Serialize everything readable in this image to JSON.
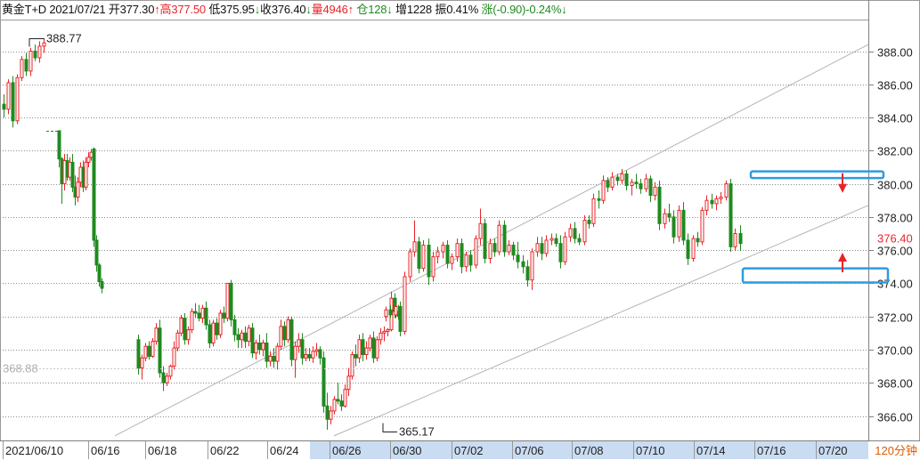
{
  "header": {
    "symbol": "黄金T+D",
    "date": "2021/07/21",
    "open_label": "开",
    "open_value": "377.30",
    "open_arrow": "↑",
    "high_label": "高",
    "high_value": "377.50",
    "low_label": "低",
    "low_value": "375.95",
    "low_arrow": "↓",
    "close_label": "收",
    "close_value": "376.40",
    "close_arrow": "↓",
    "volume_label": "量",
    "volume_value": "4946",
    "volume_arrow": "↑",
    "oi_label": "仓",
    "oi_value": "128",
    "oi_arrow": "↓",
    "inc_label": "增",
    "inc_value": "1228",
    "amp_label": "振",
    "amp_value": "0.41%",
    "chg_label": "涨",
    "chg_value": "(-0.90)-0.24%",
    "chg_arrow": "↓"
  },
  "period_label": "120分钟",
  "colors": {
    "up": "#e8252a",
    "down": "#1f8a1f",
    "grid": "#8c8c8c",
    "highlight_box": "#2f9be0",
    "date_band": "#c9dcf2",
    "trendline": "#b4b4b4",
    "signal_arrow": "#e8252a"
  },
  "chart_data": {
    "type": "candlestick",
    "y_axis": {
      "min": 364.8,
      "max": 390.0,
      "ticks": [
        "366.00",
        "368.00",
        "370.00",
        "372.00",
        "374.00",
        "376.00",
        "378.00",
        "380.00",
        "382.00",
        "384.00",
        "386.00",
        "388.00"
      ],
      "side": "right"
    },
    "x_axis": {
      "labels": [
        "2021/06/10",
        "06/16",
        "06/18",
        "06/22",
        "06/24",
        "06/26",
        "06/30",
        "07/02",
        "07/06",
        "07/08",
        "07/10",
        "07/14",
        "07/16",
        "07/20"
      ],
      "highlight_range": [
        "06/26",
        "07/20"
      ]
    },
    "annotations": {
      "max_label": "388.77",
      "max_value": 388.77,
      "min_label": "365.17",
      "min_value": 365.17,
      "ref_label": "368.88",
      "ref_value": 368.88,
      "last_label": "376.40",
      "last_value": 376.4
    },
    "channel_lines": [
      {
        "from": {
          "date": "06/16",
          "value": 364.8
        },
        "to": {
          "date": "07/20+",
          "value": 388.4
        }
      },
      {
        "from": {
          "date": "06/26",
          "value": 364.8
        },
        "to": {
          "date": "07/20+",
          "value": 378.7
        }
      }
    ],
    "zones": [
      {
        "name": "resistance",
        "low": 380.35,
        "high": 380.75
      },
      {
        "name": "support",
        "low": 374.05,
        "high": 374.9
      }
    ],
    "signals": [
      {
        "direction": "down",
        "at_value": 380.1
      },
      {
        "direction": "up",
        "at_value": 375.2
      }
    ],
    "candles": [
      [
        384.8,
        385.4,
        384.0,
        384.5
      ],
      [
        384.5,
        386.3,
        384.2,
        386.1
      ],
      [
        386.1,
        386.5,
        383.4,
        383.8
      ],
      [
        383.8,
        386.6,
        383.6,
        386.4
      ],
      [
        386.4,
        387.7,
        386.2,
        387.5
      ],
      [
        387.5,
        387.9,
        386.5,
        386.8
      ],
      [
        386.8,
        388.2,
        386.5,
        388.0
      ],
      [
        388.0,
        388.4,
        387.4,
        387.6
      ],
      [
        387.6,
        388.6,
        387.3,
        388.3
      ],
      [
        388.3,
        388.77,
        387.9,
        388.5
      ],
      [
        383.2,
        383.2,
        381.0,
        381.5
      ],
      [
        381.5,
        381.6,
        378.8,
        380.0
      ],
      [
        380.0,
        381.8,
        379.6,
        381.4
      ],
      [
        381.4,
        381.8,
        380.2,
        380.4
      ],
      [
        380.4,
        381.6,
        380.2,
        381.3
      ],
      [
        381.3,
        381.8,
        379.5,
        379.8
      ],
      [
        379.8,
        380.5,
        378.7,
        379.2
      ],
      [
        379.2,
        380.4,
        378.9,
        380.1
      ],
      [
        380.1,
        381.3,
        379.8,
        381.0
      ],
      [
        381.0,
        381.4,
        379.5,
        379.8
      ],
      [
        379.8,
        381.6,
        379.6,
        381.3
      ],
      [
        381.3,
        381.9,
        381.0,
        381.6
      ],
      [
        381.6,
        382.1,
        381.4,
        381.9
      ],
      [
        382.1,
        382.2,
        376.2,
        376.6
      ],
      [
        376.6,
        376.9,
        374.7,
        375.1
      ],
      [
        375.1,
        375.2,
        373.8,
        374.1
      ],
      [
        374.1,
        374.3,
        373.4,
        373.7
      ],
      [
        370.6,
        370.9,
        368.5,
        368.9
      ],
      [
        368.9,
        369.7,
        368.2,
        369.5
      ],
      [
        369.5,
        370.4,
        369.3,
        370.2
      ],
      [
        370.2,
        370.5,
        369.4,
        369.6
      ],
      [
        369.6,
        370.7,
        369.5,
        370.5
      ],
      [
        370.5,
        371.6,
        370.3,
        371.3
      ],
      [
        371.3,
        371.8,
        368.3,
        368.6
      ],
      [
        368.6,
        369.0,
        367.5,
        368.0
      ],
      [
        368.0,
        368.6,
        367.8,
        368.4
      ],
      [
        368.4,
        369.1,
        368.2,
        369.0
      ],
      [
        369.0,
        370.5,
        368.8,
        370.1
      ],
      [
        370.1,
        371.2,
        369.9,
        371.0
      ],
      [
        371.0,
        372.1,
        370.8,
        371.9
      ],
      [
        371.9,
        372.2,
        370.3,
        370.6
      ],
      [
        370.6,
        371.4,
        370.3,
        371.2
      ],
      [
        371.2,
        372.5,
        371.0,
        372.3
      ],
      [
        372.3,
        372.8,
        371.9,
        372.2
      ],
      [
        372.2,
        372.7,
        371.7,
        371.9
      ],
      [
        371.9,
        372.7,
        371.6,
        372.5
      ],
      [
        372.5,
        372.9,
        371.2,
        371.5
      ],
      [
        371.5,
        371.8,
        370.1,
        370.4
      ],
      [
        370.4,
        371.8,
        370.2,
        371.6
      ],
      [
        371.6,
        371.9,
        370.6,
        370.9
      ],
      [
        370.9,
        372.4,
        370.7,
        372.2
      ],
      [
        372.2,
        372.6,
        371.6,
        371.9
      ],
      [
        371.9,
        373.2,
        371.7,
        374.0
      ],
      [
        374.0,
        374.2,
        371.4,
        371.8
      ],
      [
        371.8,
        372.1,
        370.5,
        370.9
      ],
      [
        370.9,
        371.3,
        370.1,
        370.6
      ],
      [
        370.6,
        371.2,
        370.1,
        371.0
      ],
      [
        371.0,
        371.4,
        370.1,
        370.5
      ],
      [
        370.5,
        371.5,
        370.2,
        371.3
      ],
      [
        371.3,
        371.6,
        369.5,
        369.8
      ],
      [
        369.8,
        370.6,
        369.4,
        370.4
      ],
      [
        370.4,
        370.9,
        369.7,
        370.0
      ],
      [
        370.0,
        370.6,
        369.6,
        370.4
      ],
      [
        370.4,
        371.0,
        368.9,
        369.3
      ],
      [
        369.3,
        369.9,
        369.0,
        369.6
      ],
      [
        369.6,
        370.1,
        368.9,
        369.3
      ],
      [
        369.3,
        370.4,
        368.8,
        370.2
      ],
      [
        370.2,
        371.8,
        370.0,
        371.4
      ],
      [
        371.4,
        371.7,
        370.2,
        370.6
      ],
      [
        370.6,
        372.0,
        370.4,
        371.8
      ],
      [
        371.8,
        372.0,
        369.0,
        369.4
      ],
      [
        369.4,
        370.5,
        368.3,
        370.2
      ],
      [
        370.2,
        371.0,
        369.8,
        370.6
      ],
      [
        370.6,
        371.0,
        369.1,
        369.5
      ],
      [
        369.5,
        370.1,
        369.3,
        369.7
      ],
      [
        369.7,
        370.1,
        369.3,
        369.5
      ],
      [
        369.5,
        370.2,
        369.2,
        369.9
      ],
      [
        369.9,
        370.4,
        369.6,
        370.0
      ],
      [
        370.0,
        370.2,
        369.1,
        369.5
      ],
      [
        369.5,
        369.9,
        366.2,
        366.6
      ],
      [
        366.6,
        367.4,
        365.17,
        365.8
      ],
      [
        365.8,
        366.6,
        365.5,
        366.3
      ],
      [
        366.3,
        367.2,
        366.1,
        367.0
      ],
      [
        367.0,
        368.0,
        366.7,
        366.9
      ],
      [
        366.9,
        367.3,
        366.3,
        366.6
      ],
      [
        366.6,
        367.9,
        366.5,
        367.6
      ],
      [
        367.6,
        368.9,
        367.2,
        368.4
      ],
      [
        368.4,
        369.9,
        368.2,
        369.7
      ],
      [
        369.7,
        370.3,
        369.0,
        369.5
      ],
      [
        369.5,
        370.9,
        369.2,
        370.6
      ],
      [
        370.6,
        371.0,
        369.3,
        369.7
      ],
      [
        369.7,
        370.5,
        369.4,
        370.1
      ],
      [
        370.1,
        370.9,
        369.9,
        370.7
      ],
      [
        370.7,
        371.1,
        369.2,
        369.5
      ],
      [
        369.5,
        370.8,
        369.3,
        370.6
      ],
      [
        370.6,
        371.3,
        370.3,
        371.0
      ],
      [
        371.0,
        371.4,
        370.5,
        371.1
      ],
      [
        371.1,
        371.3,
        370.8,
        371.2
      ],
      [
        371.2,
        373.5,
        371.1,
        373.1
      ],
      [
        373.1,
        373.4,
        371.9,
        372.3
      ],
      [
        372.3,
        372.7,
        371.8,
        372.0
      ],
      [
        372.0,
        372.6,
        371.7,
        372.4
      ],
      [
        372.4,
        372.7,
        371.9,
        372.1
      ],
      [
        372.1,
        372.8,
        371.9,
        372.6
      ],
      [
        372.6,
        372.9,
        370.8,
        371.1
      ],
      [
        371.1,
        374.7,
        370.9,
        374.4
      ],
      [
        374.4,
        376.1,
        374.1,
        375.9
      ],
      [
        375.9,
        377.8,
        375.6,
        376.5
      ],
      [
        376.5,
        376.8,
        374.6,
        374.9
      ],
      [
        374.9,
        376.6,
        374.7,
        376.3
      ],
      [
        376.3,
        376.7,
        373.9,
        374.4
      ],
      [
        374.4,
        375.9,
        374.1,
        375.6
      ],
      [
        375.6,
        376.2,
        375.2,
        375.9
      ],
      [
        375.9,
        376.5,
        375.5,
        376.3
      ],
      [
        376.3,
        376.6,
        374.9,
        375.2
      ],
      [
        375.2,
        375.8,
        374.8,
        375.6
      ],
      [
        375.6,
        376.7,
        375.3,
        376.4
      ],
      [
        376.4,
        376.7,
        374.6,
        375.0
      ],
      [
        375.0,
        375.9,
        374.7,
        375.7
      ],
      [
        375.7,
        376.0,
        374.7,
        375.1
      ],
      [
        375.1,
        376.9,
        374.9,
        376.7
      ],
      [
        376.7,
        378.5,
        376.3,
        377.6
      ],
      [
        377.6,
        377.9,
        375.2,
        375.5
      ],
      [
        375.5,
        376.7,
        375.2,
        376.4
      ],
      [
        376.4,
        376.7,
        375.6,
        375.9
      ],
      [
        375.9,
        377.8,
        375.7,
        377.5
      ],
      [
        377.5,
        377.8,
        375.6,
        375.9
      ],
      [
        375.9,
        376.6,
        375.7,
        376.3
      ],
      [
        376.3,
        376.5,
        375.4,
        375.7
      ],
      [
        375.7,
        376.5,
        374.9,
        375.3
      ],
      [
        375.3,
        375.7,
        374.6,
        375.0
      ],
      [
        375.0,
        375.4,
        373.8,
        374.2
      ],
      [
        374.2,
        376.1,
        373.6,
        375.9
      ],
      [
        375.9,
        376.8,
        375.6,
        376.4
      ],
      [
        376.4,
        376.8,
        375.4,
        375.8
      ],
      [
        375.8,
        376.9,
        375.6,
        376.6
      ],
      [
        376.6,
        377.0,
        376.3,
        376.7
      ],
      [
        376.7,
        377.0,
        376.2,
        376.4
      ],
      [
        376.4,
        376.9,
        374.9,
        375.3
      ],
      [
        375.3,
        377.1,
        375.1,
        376.8
      ],
      [
        376.8,
        377.6,
        376.5,
        377.3
      ],
      [
        377.3,
        377.7,
        376.4,
        376.7
      ],
      [
        376.7,
        377.0,
        376.3,
        376.5
      ],
      [
        376.5,
        378.1,
        376.3,
        377.8
      ],
      [
        377.8,
        378.1,
        377.3,
        377.6
      ],
      [
        377.6,
        379.4,
        377.4,
        379.1
      ],
      [
        379.1,
        379.6,
        378.5,
        379.0
      ],
      [
        379.0,
        380.5,
        378.8,
        380.2
      ],
      [
        380.2,
        380.4,
        379.5,
        379.8
      ],
      [
        379.8,
        380.7,
        379.6,
        380.4
      ],
      [
        380.4,
        380.6,
        379.9,
        380.2
      ],
      [
        380.2,
        380.9,
        380.0,
        380.6
      ],
      [
        380.6,
        380.8,
        379.6,
        379.9
      ],
      [
        379.9,
        380.3,
        379.3,
        380.1
      ],
      [
        380.1,
        380.6,
        379.7,
        380.0
      ],
      [
        380.0,
        380.3,
        379.4,
        379.7
      ],
      [
        379.7,
        380.6,
        379.5,
        380.3
      ],
      [
        380.3,
        380.5,
        378.9,
        379.3
      ],
      [
        379.3,
        380.1,
        379.0,
        379.8
      ],
      [
        379.8,
        380.2,
        377.2,
        377.6
      ],
      [
        377.6,
        378.5,
        377.3,
        378.2
      ],
      [
        378.2,
        378.8,
        377.7,
        378.0
      ],
      [
        378.0,
        378.4,
        376.4,
        376.8
      ],
      [
        376.8,
        378.7,
        376.5,
        378.4
      ],
      [
        378.4,
        378.9,
        376.3,
        376.6
      ],
      [
        376.6,
        377.0,
        375.1,
        375.5
      ],
      [
        375.5,
        376.9,
        375.3,
        376.7
      ],
      [
        376.7,
        377.1,
        376.2,
        376.5
      ],
      [
        376.5,
        378.6,
        376.3,
        378.4
      ],
      [
        378.4,
        379.3,
        378.1,
        379.0
      ],
      [
        379.0,
        379.4,
        378.5,
        378.8
      ],
      [
        378.8,
        379.3,
        378.4,
        379.1
      ],
      [
        379.1,
        379.5,
        378.8,
        379.2
      ],
      [
        379.2,
        380.2,
        379.0,
        380.0
      ],
      [
        380.0,
        380.3,
        375.9,
        376.2
      ],
      [
        376.2,
        377.3,
        375.95,
        377.0
      ],
      [
        377.0,
        377.5,
        375.95,
        376.4
      ]
    ]
  }
}
